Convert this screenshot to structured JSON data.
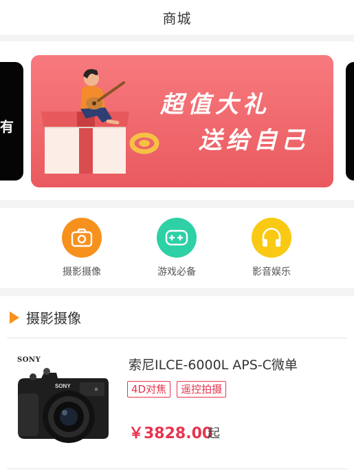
{
  "header": {
    "title": "商城"
  },
  "banner": {
    "left_peek_text": "有",
    "slogan_line1": "超值大礼",
    "slogan_line2": "送给自己"
  },
  "categories": [
    {
      "label": "摄影摄像",
      "icon": "camera-icon",
      "color": "#f7911e"
    },
    {
      "label": "游戏必备",
      "icon": "gamepad-icon",
      "color": "#2ed0a6"
    },
    {
      "label": "影音娱乐",
      "icon": "headphones-icon",
      "color": "#f9c913"
    }
  ],
  "section": {
    "title": "摄影摄像",
    "accent": "#f7911e",
    "products": [
      {
        "brand": "SONY",
        "name": "索尼ILCE-6000L APS-C微单",
        "tags": [
          "4D对焦",
          "遥控拍摄"
        ],
        "price": "￥3828.00",
        "price_suffix": "起"
      }
    ]
  },
  "colors": {
    "price": "#e8344e",
    "banner": "#f0686c"
  }
}
